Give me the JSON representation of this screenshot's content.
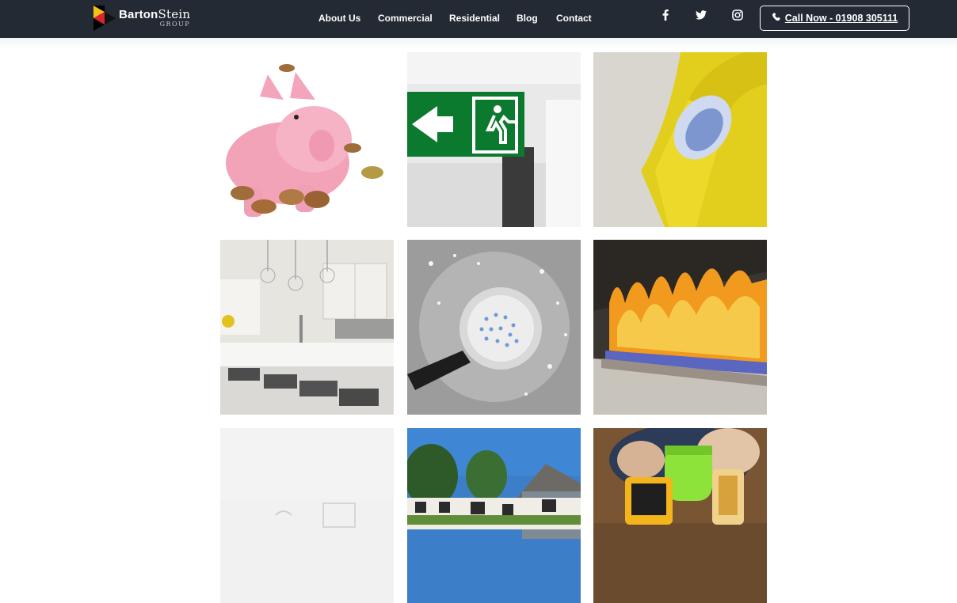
{
  "brand": {
    "name_bold": "Barton",
    "name_thin": "Stein",
    "sub": "GROUP"
  },
  "nav": {
    "items": [
      {
        "label": "About Us"
      },
      {
        "label": "Commercial"
      },
      {
        "label": "Residential"
      },
      {
        "label": "Blog"
      },
      {
        "label": "Contact"
      }
    ]
  },
  "social": {
    "icons": [
      "facebook-icon",
      "twitter-icon",
      "instagram-icon"
    ]
  },
  "cta": {
    "label": "Call Now - 01908 305111",
    "icon": "phone-icon"
  },
  "gallery": {
    "tiles": [
      {
        "subject": "piggy-bank"
      },
      {
        "subject": "fire-exit-sign"
      },
      {
        "subject": "yellow-armchair"
      },
      {
        "subject": "white-kitchen"
      },
      {
        "subject": "shower-head"
      },
      {
        "subject": "fireplace"
      },
      {
        "subject": "white-interior"
      },
      {
        "subject": "house-exterior"
      },
      {
        "subject": "power-drills"
      }
    ]
  },
  "colors": {
    "header_bg": "#232a33",
    "header_text": "#ffffff"
  }
}
